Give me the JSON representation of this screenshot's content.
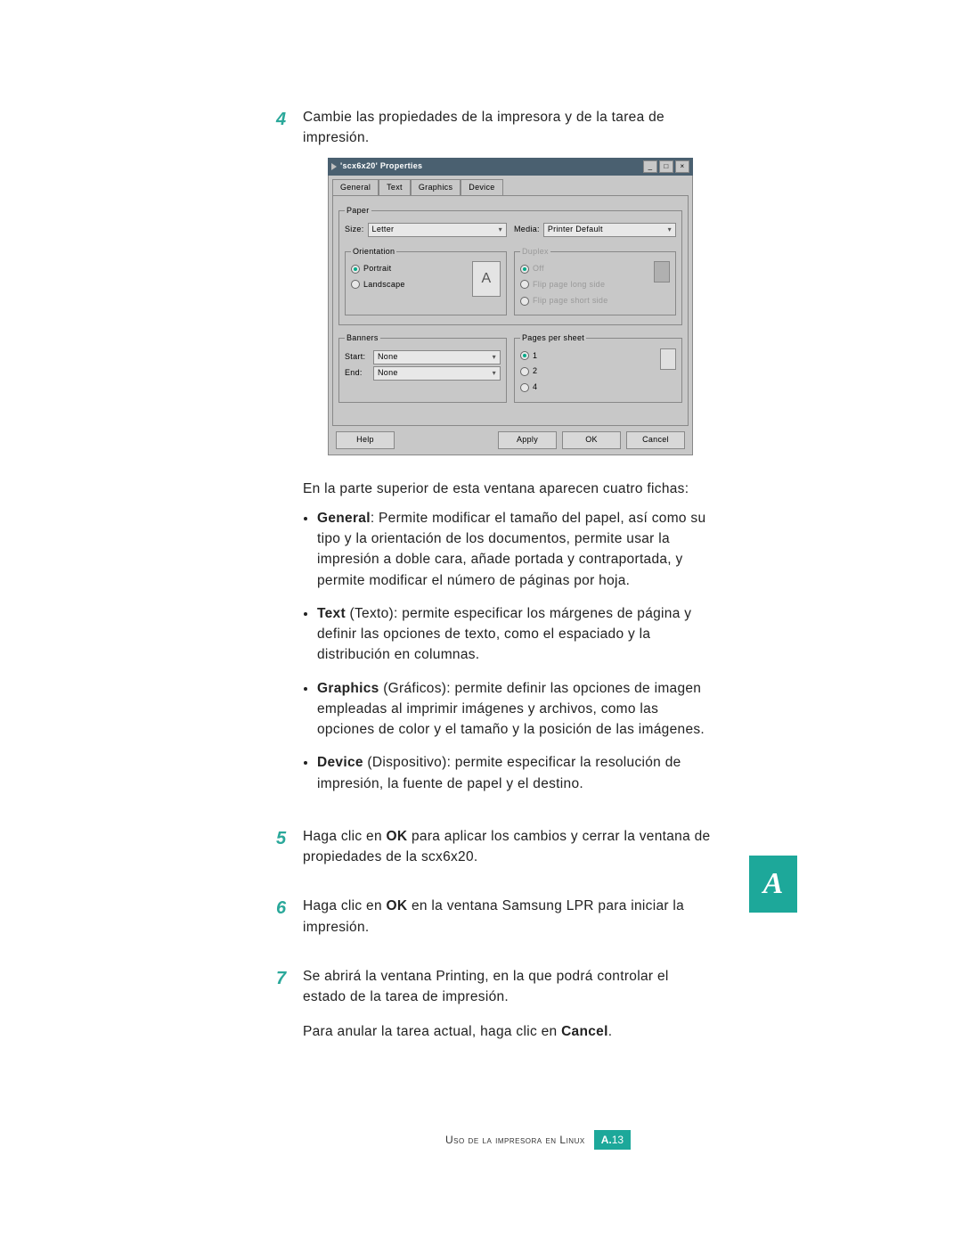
{
  "steps": {
    "s4": {
      "num": "4",
      "intro": "Cambie las propiedades de la impresora y de la tarea de impresión.",
      "after_dialog": "En la parte superior de esta ventana aparecen cuatro fichas:",
      "bullets": {
        "b1": {
          "label": "General",
          "text": ": Permite modificar el tamaño del papel, así como su tipo y la orientación de los documentos, permite usar la impresión a doble cara, añade portada y contraportada, y permite modificar el número de páginas por hoja."
        },
        "b2": {
          "label": "Text",
          "paren": " (Texto): ",
          "text": "permite especificar los márgenes de página y definir las opciones de texto, como el espaciado y la distribución en columnas."
        },
        "b3": {
          "label": "Graphics",
          "paren": " (Gráficos): ",
          "text": "permite definir las opciones de imagen empleadas al imprimir imágenes y archivos, como las opciones de color y el tamaño y la posición de las imágenes."
        },
        "b4": {
          "label": "Device",
          "paren": " (Dispositivo): ",
          "text": "permite especificar la resolución de impresión, la fuente de papel y el destino."
        }
      }
    },
    "s5": {
      "num": "5",
      "pre": "Haga clic en ",
      "bold": "OK",
      "post": " para aplicar los cambios y cerrar la ventana de propiedades de la scx6x20."
    },
    "s6": {
      "num": "6",
      "pre": "Haga clic en ",
      "bold": "OK",
      "post": " en la ventana Samsung LPR para iniciar la impresión."
    },
    "s7": {
      "num": "7",
      "text": "Se abrirá la ventana Printing, en la que podrá controlar el estado de la tarea de impresión.",
      "cancel_pre": "Para anular la tarea actual, haga clic en ",
      "cancel_bold": "Cancel",
      "cancel_post": "."
    }
  },
  "dialog": {
    "title": "'scx6x20' Properties",
    "tabs": {
      "general": "General",
      "text": "Text",
      "graphics": "Graphics",
      "device": "Device"
    },
    "paper": {
      "legend": "Paper",
      "size_label": "Size:",
      "size_value": "Letter",
      "media_label": "Media:",
      "media_value": "Printer Default",
      "orientation_legend": "Orientation",
      "portrait": "Portrait",
      "landscape": "Landscape",
      "duplex_legend": "Duplex",
      "duplex_off": "Off",
      "duplex_long": "Flip page long side",
      "duplex_short": "Flip page short side"
    },
    "banners": {
      "legend": "Banners",
      "start_label": "Start:",
      "start_value": "None",
      "end_label": "End:",
      "end_value": "None"
    },
    "pps": {
      "legend": "Pages per sheet",
      "one": "1",
      "two": "2",
      "four": "4"
    },
    "buttons": {
      "help": "Help",
      "apply": "Apply",
      "ok": "OK",
      "cancel": "Cancel"
    }
  },
  "side_tab": "A",
  "footer": {
    "text": "Uso de la impresora en Linux",
    "page_prefix": "A.",
    "page_num": "13"
  }
}
